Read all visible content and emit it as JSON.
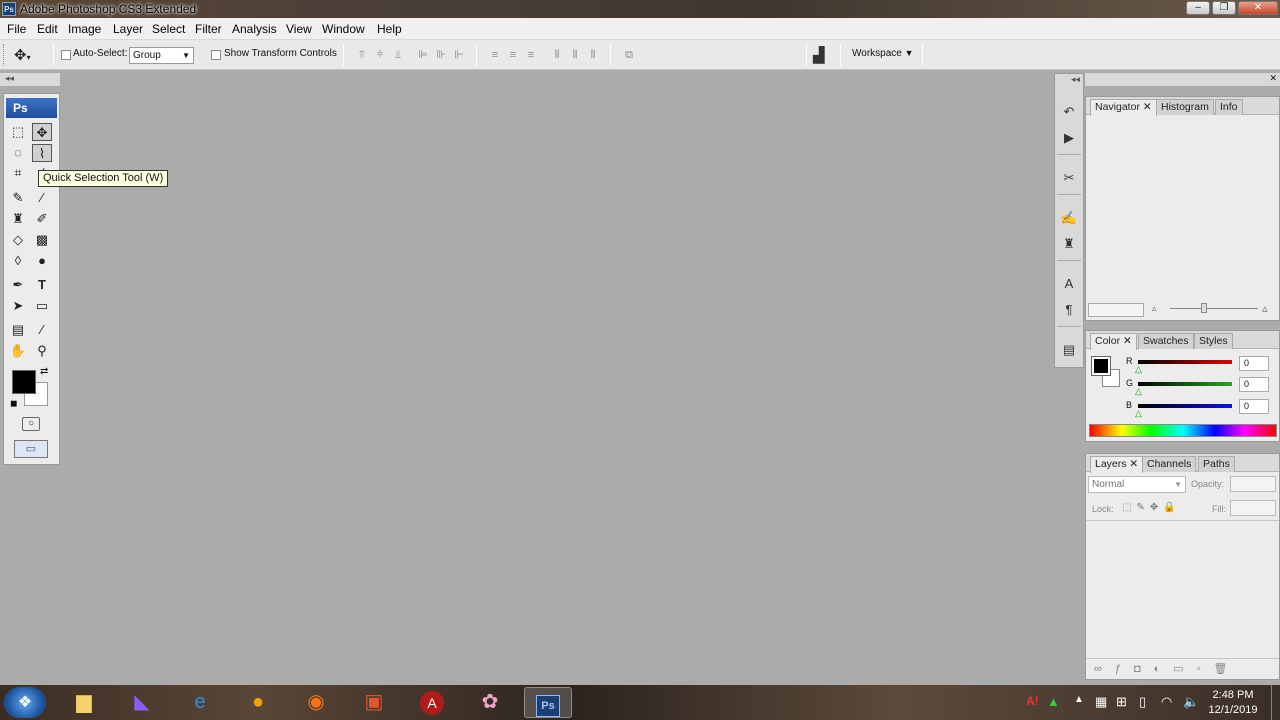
{
  "window": {
    "title": "Adobe Photoshop CS3 Extended",
    "app_badge": "Ps",
    "controls": {
      "minimize": "–",
      "restore": "❐",
      "close": "✕"
    }
  },
  "menu": [
    "File",
    "Edit",
    "Image",
    "Layer",
    "Select",
    "Filter",
    "Analysis",
    "View",
    "Window",
    "Help"
  ],
  "options_bar": {
    "auto_select_label": "Auto-Select:",
    "auto_select_value": "Group",
    "transform_label": "Show Transform Controls",
    "workspace_label": "Workspace"
  },
  "toolbox": {
    "logo": "Ps",
    "tooltip": "Quick Selection Tool (W)",
    "active_tool": "quick-selection-tool"
  },
  "panels": {
    "navigator": {
      "tabs": [
        "Navigator",
        "Histogram",
        "Info"
      ],
      "active": "Navigator"
    },
    "color": {
      "tabs": [
        "Color",
        "Swatches",
        "Styles"
      ],
      "active": "Color",
      "channels": [
        {
          "label": "R",
          "value": "0",
          "color": "#e00000"
        },
        {
          "label": "G",
          "value": "0",
          "color": "#1faa1f"
        },
        {
          "label": "B",
          "value": "0",
          "color": "#1010dd"
        }
      ]
    },
    "layers": {
      "tabs": [
        "Layers",
        "Channels",
        "Paths"
      ],
      "active": "Layers",
      "blend_mode": "Normal",
      "opacity_label": "Opacity:",
      "lock_label": "Lock:",
      "fill_label": "Fill:"
    }
  },
  "taskbar": {
    "clock_time": "2:48 PM",
    "clock_date": "12/1/2019"
  },
  "colors": {
    "canvas_bg": "#ababab",
    "foreground": "#000000",
    "background": "#ffffff",
    "tooltip_bg": "#ffffe1"
  }
}
